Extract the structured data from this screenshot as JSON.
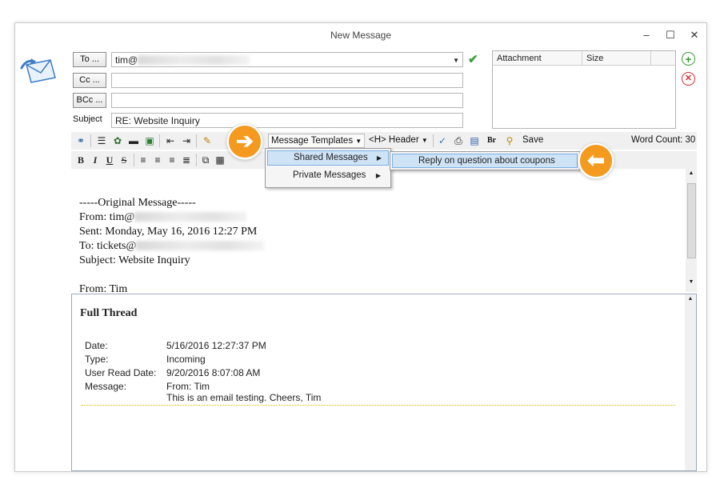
{
  "window": {
    "title": "New Message",
    "controls": {
      "minimize": "–",
      "maximize": "☐",
      "close": "✕"
    }
  },
  "fields": {
    "to_button": "To ...",
    "to_value": "tim@",
    "cc_button": "Cc ...",
    "bcc_button": "BCc ...",
    "subject_label": "Subject",
    "subject_value": "RE: Website Inquiry"
  },
  "attachments": {
    "columns": [
      "Attachment",
      "Size"
    ]
  },
  "toolbar": {
    "message_templates": "Message Templates",
    "header": "<H> Header",
    "br": "Br",
    "save": "Save",
    "word_count": "Word Count: 30",
    "format_bold": "B",
    "format_italic": "I",
    "format_underline": "U",
    "format_strike": "S"
  },
  "template_menu": {
    "items": [
      {
        "label": "Shared Messages"
      },
      {
        "label": "Private Messages"
      }
    ],
    "submenu_item": "Reply on question about coupons"
  },
  "editor": {
    "lines": [
      "-----Original Message-----",
      "From: tim@",
      "Sent: Monday, May 16, 2016 12:27 PM",
      "To: tickets@",
      "Subject: Website Inquiry",
      "",
      "From: Tim"
    ]
  },
  "thread": {
    "title": "Full Thread",
    "rows": [
      {
        "label": "Date:",
        "value": "5/16/2016 12:27:37 PM"
      },
      {
        "label": "Type:",
        "value": "Incoming"
      },
      {
        "label": "User Read Date:",
        "value": "9/20/2016 8:07:08 AM"
      },
      {
        "label": "Message:",
        "value": "From: Tim"
      }
    ],
    "message_body": "This is an email testing. Cheers, Tim"
  },
  "colors": {
    "accent": "#f39a1f",
    "ok_green": "#3a9d3a",
    "remove_red": "#d33333",
    "highlight": "#cfe3f6"
  }
}
